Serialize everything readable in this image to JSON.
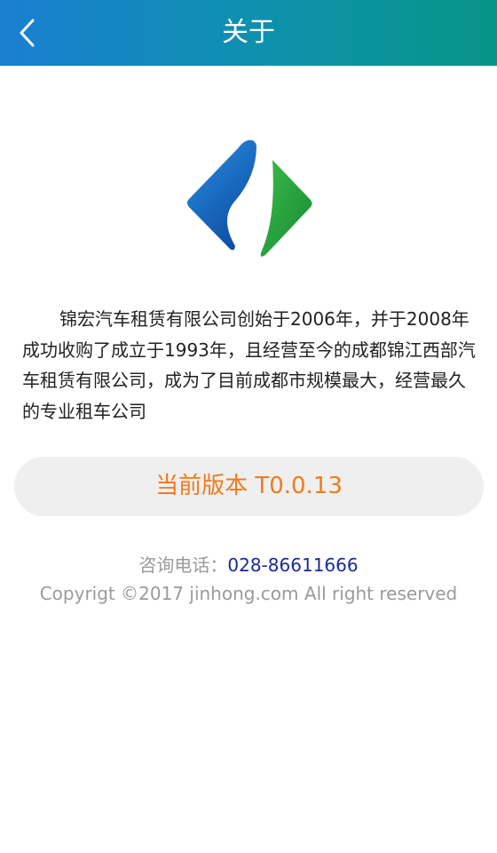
{
  "header": {
    "title": "关于",
    "back_icon": "chevron-left-icon",
    "gradient_colors": [
      "#1a7fd1",
      "#079486"
    ]
  },
  "logo": {
    "icon": "company-logo",
    "colors": [
      "#1565c0",
      "#2eaa3c"
    ]
  },
  "intro": {
    "text": "锦宏汽车租赁有限公司创始于2006年，并于2008年成功收购了成立于1993年，且经营至今的成都锦江西部汽车租赁有限公司，成为了目前成都市规模最大，经营最久的专业租车公司"
  },
  "version": {
    "label": "当前版本 T0.0.13",
    "color": "#f07b1d"
  },
  "contact": {
    "label": "咨询电话：",
    "phone": "028-86611666"
  },
  "footer": {
    "copyright": "Copyrigt ©2017 jinhong.com All right reserved"
  }
}
